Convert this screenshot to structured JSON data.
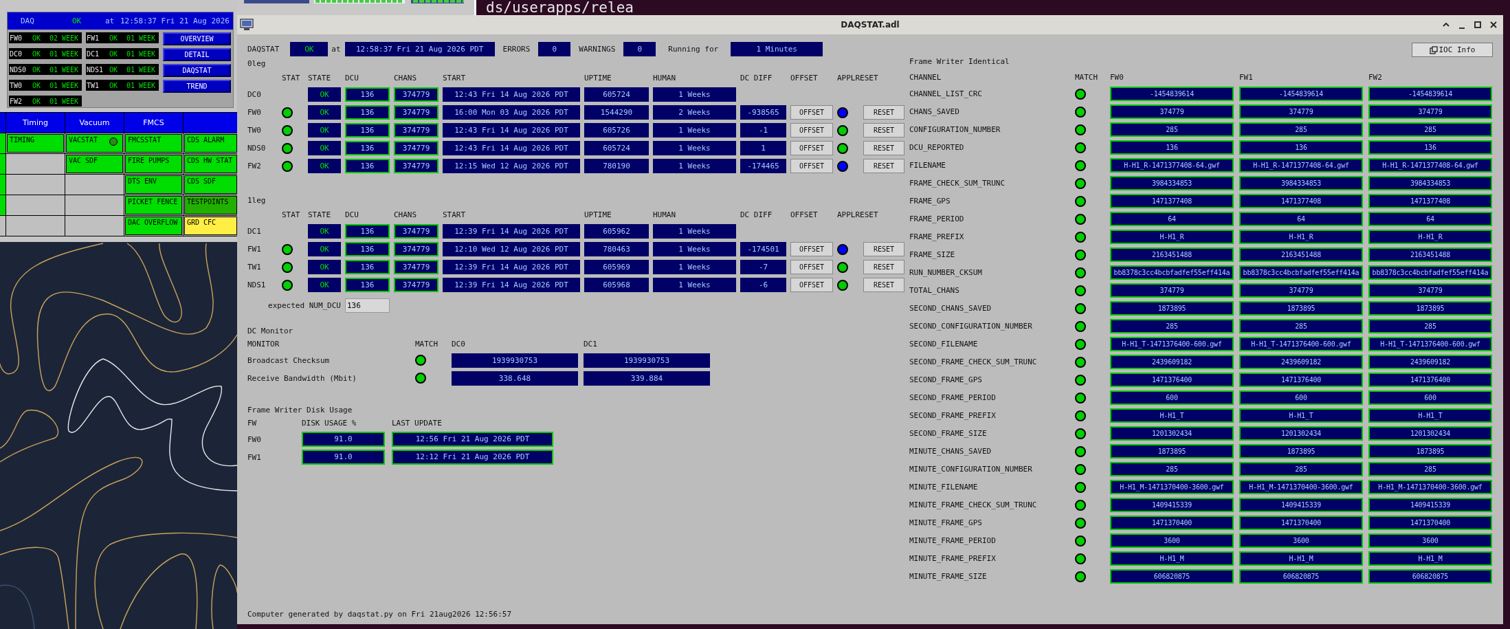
{
  "daq_panel": {
    "title": "DAQ",
    "state": "OK",
    "at": "at",
    "time": "12:58:37 Fri 21 Aug 2026",
    "nodes": [
      {
        "name": "FW0",
        "state": "OK",
        "age": "02 WEEK"
      },
      {
        "name": "FW1",
        "state": "OK",
        "age": "01 WEEK"
      },
      {
        "name": "DC0",
        "state": "OK",
        "age": "01 WEEK"
      },
      {
        "name": "DC1",
        "state": "OK",
        "age": "01 WEEK"
      },
      {
        "name": "NDS0",
        "state": "OK",
        "age": "01 WEEK"
      },
      {
        "name": "NDS1",
        "state": "OK",
        "age": "01 WEEK"
      },
      {
        "name": "TW0",
        "state": "OK",
        "age": "01 WEEK"
      },
      {
        "name": "TW1",
        "state": "OK",
        "age": "01 WEEK"
      },
      {
        "name": "FW2",
        "state": "OK",
        "age": "01 WEEK"
      }
    ],
    "buttons": [
      "OVERVIEW",
      "DETAIL",
      "DAQSTAT",
      "TREND"
    ]
  },
  "overview_grid": {
    "columns": [
      "",
      "Timing",
      "Vacuum",
      "FMCS",
      ""
    ],
    "rows": [
      {
        "cells": [
          {
            "kind": "edge",
            "color": "#00dd00"
          },
          {
            "kind": "tile",
            "label": "TIMING",
            "color": "#00dd00"
          },
          {
            "kind": "tile",
            "label": "VACSTAT",
            "color": "#00dd00",
            "light": {
              "color": "#2e8a1a"
            }
          },
          {
            "kind": "tile",
            "label": "FMCSSTAT",
            "color": "#00dd00"
          },
          {
            "kind": "tile",
            "label": "CDS ALARM",
            "color": "#00dd00"
          }
        ]
      },
      {
        "cells": [
          {
            "kind": "edge",
            "color": "#00dd00"
          },
          {
            "kind": "empty"
          },
          {
            "kind": "tile",
            "label": "VAC SDF",
            "color": "#00dd00"
          },
          {
            "kind": "tile",
            "label": "FIRE PUMPS",
            "color": "#00dd00"
          },
          {
            "kind": "tile",
            "label": "CDS HW STAT",
            "color": "#00dd00"
          }
        ]
      },
      {
        "cells": [
          {
            "kind": "edge",
            "color": "#00dd00"
          },
          {
            "kind": "empty"
          },
          {
            "kind": "empty"
          },
          {
            "kind": "tile",
            "label": "DTS ENV",
            "color": "#00dd00"
          },
          {
            "kind": "tile",
            "label": "CDS SDF",
            "color": "#00dd00"
          }
        ]
      },
      {
        "cells": [
          {
            "kind": "edge",
            "color": "#00dd00"
          },
          {
            "kind": "empty"
          },
          {
            "kind": "empty"
          },
          {
            "kind": "tile",
            "label": "PICKET FENCE",
            "color": "#00dd00"
          },
          {
            "kind": "tile",
            "label": "TESTPOINTS",
            "color": "#22b000"
          }
        ]
      },
      {
        "cells": [
          {
            "kind": "empty"
          },
          {
            "kind": "empty"
          },
          {
            "kind": "empty"
          },
          {
            "kind": "tile",
            "label": "DAC OVERFLOW",
            "color": "#00dd00"
          },
          {
            "kind": "tile",
            "label": "GRD CFC",
            "color": "#ffee44"
          }
        ]
      }
    ]
  },
  "terminal": {
    "text": "ds/userapps/relea"
  },
  "window": {
    "title": "DAQSTAT.adl"
  },
  "daqstat": {
    "label": "DAQSTAT",
    "state": "OK",
    "at": "at",
    "time": "12:58:37 Fri 21 Aug 2026 PDT",
    "errors_label": "ERRORS",
    "errors": "0",
    "warnings_label": "WARNINGS",
    "warnings": "0",
    "running_label": "Running for",
    "running": "1 Minutes"
  },
  "legs": [
    {
      "title": "0leg",
      "columns": [
        "STAT",
        "STATE",
        "DCU",
        "CHANS",
        "START",
        "UPTIME",
        "HUMAN",
        "DC DIFF",
        "OFFSET",
        "APPLRESET"
      ],
      "rows": [
        {
          "kind": "dc",
          "name": "DC0",
          "state": "OK",
          "dcu": "136",
          "chans": "374779",
          "start": "12:43 Fri 14 Aug 2026 PDT",
          "uptime": "605724",
          "human": "1 Weeks"
        },
        {
          "kind": "writer",
          "name": "FW0",
          "stat": true,
          "state": "OK",
          "dcu": "136",
          "chans": "374779",
          "start": "16:00 Mon 03 Aug 2026 PDT",
          "uptime": "1544290",
          "human": "2 Weeks",
          "dc_diff": "-938565",
          "offset": "OFFSET",
          "reset": "RESET",
          "applreset": {
            "color": "#0000ff"
          }
        },
        {
          "kind": "writer",
          "name": "TW0",
          "stat": true,
          "state": "OK",
          "dcu": "136",
          "chans": "374779",
          "start": "12:43 Fri 14 Aug 2026 PDT",
          "uptime": "605726",
          "human": "1 Weeks",
          "dc_diff": "-1",
          "offset": "OFFSET",
          "reset": "RESET",
          "applreset": {
            "color": "#00cc00"
          }
        },
        {
          "kind": "writer",
          "name": "NDS0",
          "stat": true,
          "state": "OK",
          "dcu": "136",
          "chans": "374779",
          "start": "12:43 Fri 14 Aug 2026 PDT",
          "uptime": "605724",
          "human": "1 Weeks",
          "dc_diff": "1",
          "offset": "OFFSET",
          "reset": "RESET",
          "applreset": {
            "color": "#00cc00"
          }
        },
        {
          "kind": "writer",
          "name": "FW2",
          "stat": true,
          "state": "OK",
          "dcu": "136",
          "chans": "374779",
          "start": "12:15 Wed 12 Aug 2026 PDT",
          "uptime": "780190",
          "human": "1 Weeks",
          "dc_diff": "-174465",
          "offset": "OFFSET",
          "reset": "RESET",
          "applreset": {
            "color": "#0000ff"
          }
        }
      ]
    },
    {
      "title": "1leg",
      "columns": [
        "STAT",
        "STATE",
        "DCU",
        "CHANS",
        "START",
        "UPTIME",
        "HUMAN",
        "DC DIFF",
        "OFFSET",
        "APPLRESET"
      ],
      "rows": [
        {
          "kind": "dc",
          "name": "DC1",
          "state": "OK",
          "dcu": "136",
          "chans": "374779",
          "start": "12:39 Fri 14 Aug 2026 PDT",
          "uptime": "605962",
          "human": "1 Weeks"
        },
        {
          "kind": "writer",
          "name": "FW1",
          "stat": true,
          "state": "OK",
          "dcu": "136",
          "chans": "374779",
          "start": "12:10 Wed 12 Aug 2026 PDT",
          "uptime": "780463",
          "human": "1 Weeks",
          "dc_diff": "-174501",
          "offset": "OFFSET",
          "reset": "RESET",
          "applreset": {
            "color": "#0000ff"
          }
        },
        {
          "kind": "writer",
          "name": "TW1",
          "stat": true,
          "state": "OK",
          "dcu": "136",
          "chans": "374779",
          "start": "12:39 Fri 14 Aug 2026 PDT",
          "uptime": "605969",
          "human": "1 Weeks",
          "dc_diff": "-7",
          "offset": "OFFSET",
          "reset": "RESET",
          "applreset": {
            "color": "#00cc00"
          }
        },
        {
          "kind": "writer",
          "name": "NDS1",
          "stat": true,
          "state": "OK",
          "dcu": "136",
          "chans": "374779",
          "start": "12:39 Fri 14 Aug 2026 PDT",
          "uptime": "605968",
          "human": "1 Weeks",
          "dc_diff": "-6",
          "offset": "OFFSET",
          "reset": "RESET",
          "applreset": {
            "color": "#00cc00"
          }
        }
      ]
    }
  ],
  "expected": {
    "label": "expected NUM_DCU",
    "value": "136"
  },
  "dc_monitor": {
    "title": "DC Monitor",
    "columns": [
      "MONITOR",
      "MATCH",
      "DC0",
      "DC1"
    ],
    "rows": [
      {
        "name": "Broadcast Checksum",
        "match": true,
        "values": [
          "1939930753",
          "1939930753"
        ]
      },
      {
        "name": "Receive Bandwidth (Mbit)",
        "match": true,
        "values": [
          "338.648",
          "339.884"
        ]
      }
    ]
  },
  "disk_usage": {
    "title": "Frame Writer Disk Usage",
    "columns": [
      "FW",
      "DISK USAGE %",
      "LAST UPDATE"
    ],
    "rows": [
      {
        "name": "FW0",
        "usage": "91.0",
        "updated": "12:56 Fri 21 Aug 2026 PDT"
      },
      {
        "name": "FW1",
        "usage": "91.0",
        "updated": "12:12 Fri 21 Aug 2026 PDT"
      }
    ]
  },
  "footer": "Computer generated by daqstat.py on Fri 21aug2026 12:56:57",
  "ioc_button": "IOC Info",
  "identical": {
    "title": "Frame Writer Identical",
    "columns": [
      "CHANNEL",
      "MATCH",
      "FW0",
      "FW1",
      "FW2"
    ],
    "rows": [
      {
        "channel": "CHANNEL_LIST_CRC",
        "match": true,
        "values": [
          "-1454839614",
          "-1454839614",
          "-1454839614"
        ]
      },
      {
        "channel": "CHANS_SAVED",
        "match": true,
        "values": [
          "374779",
          "374779",
          "374779"
        ]
      },
      {
        "channel": "CONFIGURATION_NUMBER",
        "match": true,
        "values": [
          "285",
          "285",
          "285"
        ]
      },
      {
        "channel": "DCU_REPORTED",
        "match": true,
        "values": [
          "136",
          "136",
          "136"
        ]
      },
      {
        "channel": "FILENAME",
        "match": true,
        "values": [
          "H-H1_R-1471377408-64.gwf",
          "H-H1_R-1471377408-64.gwf",
          "H-H1_R-1471377408-64.gwf"
        ]
      },
      {
        "channel": "FRAME_CHECK_SUM_TRUNC",
        "match": true,
        "values": [
          "3984334853",
          "3984334853",
          "3984334853"
        ]
      },
      {
        "channel": "FRAME_GPS",
        "match": true,
        "values": [
          "1471377408",
          "1471377408",
          "1471377408"
        ]
      },
      {
        "channel": "FRAME_PERIOD",
        "match": true,
        "values": [
          "64",
          "64",
          "64"
        ]
      },
      {
        "channel": "FRAME_PREFIX",
        "match": true,
        "values": [
          "H-H1_R",
          "H-H1_R",
          "H-H1_R"
        ]
      },
      {
        "channel": "FRAME_SIZE",
        "match": true,
        "values": [
          "2163451488",
          "2163451488",
          "2163451488"
        ]
      },
      {
        "channel": "RUN_NUMBER_CKSUM",
        "match": true,
        "values": [
          "bb8378c3cc4bcbfadfef55eff414a",
          "bb8378c3cc4bcbfadfef55eff414a",
          "bb8378c3cc4bcbfadfef55eff414a"
        ]
      },
      {
        "channel": "TOTAL_CHANS",
        "match": true,
        "values": [
          "374779",
          "374779",
          "374779"
        ]
      },
      {
        "channel": "SECOND_CHANS_SAVED",
        "match": true,
        "values": [
          "1873895",
          "1873895",
          "1873895"
        ]
      },
      {
        "channel": "SECOND_CONFIGURATION_NUMBER",
        "match": true,
        "values": [
          "285",
          "285",
          "285"
        ]
      },
      {
        "channel": "SECOND_FILENAME",
        "match": true,
        "values": [
          "H-H1_T-1471376400-600.gwf",
          "H-H1_T-1471376400-600.gwf",
          "H-H1_T-1471376400-600.gwf"
        ]
      },
      {
        "channel": "SECOND_FRAME_CHECK_SUM_TRUNC",
        "match": true,
        "values": [
          "2439609182",
          "2439609182",
          "2439609182"
        ]
      },
      {
        "channel": "SECOND_FRAME_GPS",
        "match": true,
        "values": [
          "1471376400",
          "1471376400",
          "1471376400"
        ]
      },
      {
        "channel": "SECOND_FRAME_PERIOD",
        "match": true,
        "values": [
          "600",
          "600",
          "600"
        ]
      },
      {
        "channel": "SECOND_FRAME_PREFIX",
        "match": true,
        "values": [
          "H-H1_T",
          "H-H1_T",
          "H-H1_T"
        ]
      },
      {
        "channel": "SECOND_FRAME_SIZE",
        "match": true,
        "values": [
          "1201302434",
          "1201302434",
          "1201302434"
        ]
      },
      {
        "channel": "MINUTE_CHANS_SAVED",
        "match": true,
        "values": [
          "1873895",
          "1873895",
          "1873895"
        ]
      },
      {
        "channel": "MINUTE_CONFIGURATION_NUMBER",
        "match": true,
        "values": [
          "285",
          "285",
          "285"
        ]
      },
      {
        "channel": "MINUTE_FILENAME",
        "match": true,
        "values": [
          "H-H1_M-1471370400-3600.gwf",
          "H-H1_M-1471370400-3600.gwf",
          "H-H1_M-1471370400-3600.gwf"
        ]
      },
      {
        "channel": "MINUTE_FRAME_CHECK_SUM_TRUNC",
        "match": true,
        "values": [
          "1409415339",
          "1409415339",
          "1409415339"
        ]
      },
      {
        "channel": "MINUTE_FRAME_GPS",
        "match": true,
        "values": [
          "1471370400",
          "1471370400",
          "1471370400"
        ]
      },
      {
        "channel": "MINUTE_FRAME_PERIOD",
        "match": true,
        "values": [
          "3600",
          "3600",
          "3600"
        ]
      },
      {
        "channel": "MINUTE_FRAME_PREFIX",
        "match": true,
        "values": [
          "H-H1_M",
          "H-H1_M",
          "H-H1_M"
        ]
      },
      {
        "channel": "MINUTE_FRAME_SIZE",
        "match": true,
        "values": [
          "606820875",
          "606820875",
          "606820875"
        ]
      }
    ]
  }
}
